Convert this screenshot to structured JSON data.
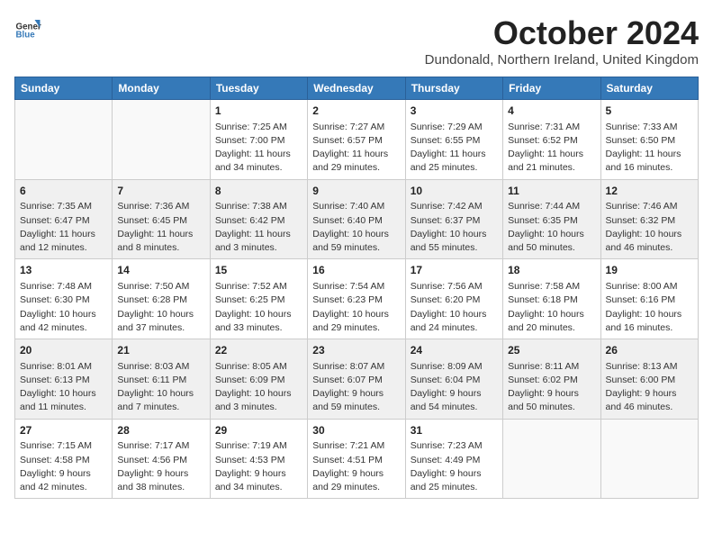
{
  "logo": {
    "line1": "General",
    "line2": "Blue"
  },
  "title": "October 2024",
  "location": "Dundonald, Northern Ireland, United Kingdom",
  "days_of_week": [
    "Sunday",
    "Monday",
    "Tuesday",
    "Wednesday",
    "Thursday",
    "Friday",
    "Saturday"
  ],
  "weeks": [
    [
      {
        "day": "",
        "info": ""
      },
      {
        "day": "",
        "info": ""
      },
      {
        "day": "1",
        "info": "Sunrise: 7:25 AM\nSunset: 7:00 PM\nDaylight: 11 hours\nand 34 minutes."
      },
      {
        "day": "2",
        "info": "Sunrise: 7:27 AM\nSunset: 6:57 PM\nDaylight: 11 hours\nand 29 minutes."
      },
      {
        "day": "3",
        "info": "Sunrise: 7:29 AM\nSunset: 6:55 PM\nDaylight: 11 hours\nand 25 minutes."
      },
      {
        "day": "4",
        "info": "Sunrise: 7:31 AM\nSunset: 6:52 PM\nDaylight: 11 hours\nand 21 minutes."
      },
      {
        "day": "5",
        "info": "Sunrise: 7:33 AM\nSunset: 6:50 PM\nDaylight: 11 hours\nand 16 minutes."
      }
    ],
    [
      {
        "day": "6",
        "info": "Sunrise: 7:35 AM\nSunset: 6:47 PM\nDaylight: 11 hours\nand 12 minutes."
      },
      {
        "day": "7",
        "info": "Sunrise: 7:36 AM\nSunset: 6:45 PM\nDaylight: 11 hours\nand 8 minutes."
      },
      {
        "day": "8",
        "info": "Sunrise: 7:38 AM\nSunset: 6:42 PM\nDaylight: 11 hours\nand 3 minutes."
      },
      {
        "day": "9",
        "info": "Sunrise: 7:40 AM\nSunset: 6:40 PM\nDaylight: 10 hours\nand 59 minutes."
      },
      {
        "day": "10",
        "info": "Sunrise: 7:42 AM\nSunset: 6:37 PM\nDaylight: 10 hours\nand 55 minutes."
      },
      {
        "day": "11",
        "info": "Sunrise: 7:44 AM\nSunset: 6:35 PM\nDaylight: 10 hours\nand 50 minutes."
      },
      {
        "day": "12",
        "info": "Sunrise: 7:46 AM\nSunset: 6:32 PM\nDaylight: 10 hours\nand 46 minutes."
      }
    ],
    [
      {
        "day": "13",
        "info": "Sunrise: 7:48 AM\nSunset: 6:30 PM\nDaylight: 10 hours\nand 42 minutes."
      },
      {
        "day": "14",
        "info": "Sunrise: 7:50 AM\nSunset: 6:28 PM\nDaylight: 10 hours\nand 37 minutes."
      },
      {
        "day": "15",
        "info": "Sunrise: 7:52 AM\nSunset: 6:25 PM\nDaylight: 10 hours\nand 33 minutes."
      },
      {
        "day": "16",
        "info": "Sunrise: 7:54 AM\nSunset: 6:23 PM\nDaylight: 10 hours\nand 29 minutes."
      },
      {
        "day": "17",
        "info": "Sunrise: 7:56 AM\nSunset: 6:20 PM\nDaylight: 10 hours\nand 24 minutes."
      },
      {
        "day": "18",
        "info": "Sunrise: 7:58 AM\nSunset: 6:18 PM\nDaylight: 10 hours\nand 20 minutes."
      },
      {
        "day": "19",
        "info": "Sunrise: 8:00 AM\nSunset: 6:16 PM\nDaylight: 10 hours\nand 16 minutes."
      }
    ],
    [
      {
        "day": "20",
        "info": "Sunrise: 8:01 AM\nSunset: 6:13 PM\nDaylight: 10 hours\nand 11 minutes."
      },
      {
        "day": "21",
        "info": "Sunrise: 8:03 AM\nSunset: 6:11 PM\nDaylight: 10 hours\nand 7 minutes."
      },
      {
        "day": "22",
        "info": "Sunrise: 8:05 AM\nSunset: 6:09 PM\nDaylight: 10 hours\nand 3 minutes."
      },
      {
        "day": "23",
        "info": "Sunrise: 8:07 AM\nSunset: 6:07 PM\nDaylight: 9 hours\nand 59 minutes."
      },
      {
        "day": "24",
        "info": "Sunrise: 8:09 AM\nSunset: 6:04 PM\nDaylight: 9 hours\nand 54 minutes."
      },
      {
        "day": "25",
        "info": "Sunrise: 8:11 AM\nSunset: 6:02 PM\nDaylight: 9 hours\nand 50 minutes."
      },
      {
        "day": "26",
        "info": "Sunrise: 8:13 AM\nSunset: 6:00 PM\nDaylight: 9 hours\nand 46 minutes."
      }
    ],
    [
      {
        "day": "27",
        "info": "Sunrise: 7:15 AM\nSunset: 4:58 PM\nDaylight: 9 hours\nand 42 minutes."
      },
      {
        "day": "28",
        "info": "Sunrise: 7:17 AM\nSunset: 4:56 PM\nDaylight: 9 hours\nand 38 minutes."
      },
      {
        "day": "29",
        "info": "Sunrise: 7:19 AM\nSunset: 4:53 PM\nDaylight: 9 hours\nand 34 minutes."
      },
      {
        "day": "30",
        "info": "Sunrise: 7:21 AM\nSunset: 4:51 PM\nDaylight: 9 hours\nand 29 minutes."
      },
      {
        "day": "31",
        "info": "Sunrise: 7:23 AM\nSunset: 4:49 PM\nDaylight: 9 hours\nand 25 minutes."
      },
      {
        "day": "",
        "info": ""
      },
      {
        "day": "",
        "info": ""
      }
    ]
  ]
}
